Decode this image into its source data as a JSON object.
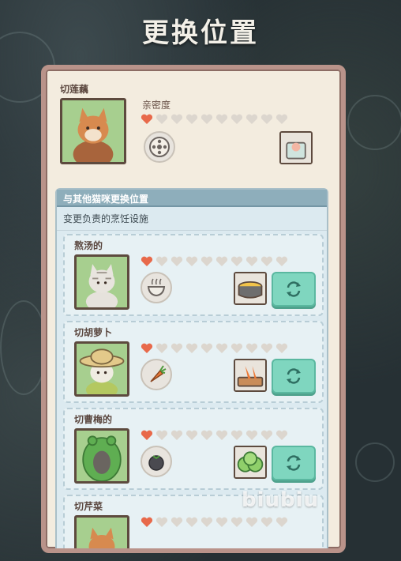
{
  "screen_title": "更换位置",
  "watermark": "biubiu",
  "current_cat": {
    "role": "切莲藕",
    "intimacy_label": "亲密度",
    "hearts_filled": 1,
    "hearts_total": 10,
    "dish_icon": "lotus-root-icon",
    "facility_icon": "lotus-prep-station-icon"
  },
  "swap_section": {
    "header": "与其他猫咪更换位置",
    "description": "变更负责的烹饪设施"
  },
  "cats": [
    {
      "role": "熬汤的",
      "hearts_filled": 1,
      "hearts_total": 10,
      "dish_icon": "soup-bowl-icon",
      "facility_icon": "soup-pot-icon"
    },
    {
      "role": "切胡萝卜",
      "hearts_filled": 1,
      "hearts_total": 10,
      "dish_icon": "carrot-icon",
      "facility_icon": "carrot-board-icon"
    },
    {
      "role": "切曹梅的",
      "hearts_filled": 1,
      "hearts_total": 10,
      "dish_icon": "berry-icon",
      "facility_icon": "cabbage-icon"
    },
    {
      "role": "切芹菜",
      "hearts_filled": 1,
      "hearts_total": 10,
      "dish_icon": "celery-icon",
      "facility_icon": "celery-board-icon"
    }
  ],
  "colors": {
    "heart_filled": "#e8694a",
    "heart_empty": "#dcd6ce",
    "swap_button": "#7fd6bf",
    "panel_border": "#b9938a"
  }
}
